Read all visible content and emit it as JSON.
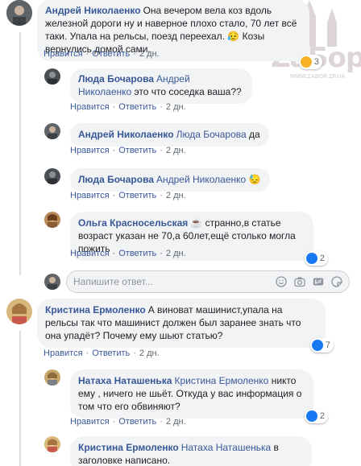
{
  "actions": {
    "like": "Нравится",
    "reply": "Ответить",
    "sep": "·"
  },
  "comments": [
    {
      "author": "Андрей Николаенко",
      "text": "Она вечером вела коз вдоль железной дороги ну и наверное плохо стало, 70 лет всё таки. Упала на рельсы, поезд переехал. 😥 Козы вернулись домой сами.",
      "time": "2 дн.",
      "reaction": {
        "icon": "sad-reaction-icon",
        "count": "3"
      }
    },
    {
      "author": "Люда Бочарова",
      "mention": "Андрей Николаенко",
      "text": "это что соседка ваша??",
      "time": "2 дн."
    },
    {
      "author": "Андрей Николаенко",
      "mention": "Люда Бочарова",
      "text": "да",
      "time": "2 дн."
    },
    {
      "author": "Люда Бочарова",
      "mention": "Андрей Николаенко",
      "text": "😓",
      "time": "2 дн."
    },
    {
      "author": "Ольга Красносельская",
      "text": "☕ странно,в статье возраст указан не 70,а 60лет,ещё столько могла пожить",
      "time": "2 дн.",
      "reaction": {
        "icon": "like-reaction-icon",
        "count": "2"
      }
    },
    {
      "author": "Кристина Ермоленко",
      "text": "А виноват машинист,упала на рельсы так что машинист должен был заранее знать что она упадёт? Почему ему шьют статью?",
      "time": "2 дн.",
      "reaction": {
        "icon": "like-reaction-icon",
        "count": "7"
      }
    },
    {
      "author": "Натаха Наташенька",
      "mention": "Кристина Ермоленко",
      "text": "никто ему , ничего не шьёт. Откуда у вас информация о том что его обвиняют?",
      "time": "2 дн.",
      "reaction": {
        "icon": "like-reaction-icon",
        "count": "2"
      }
    },
    {
      "author": "Кристина Ермоленко",
      "mention": "Натаха Наташенька",
      "text": "в заголовке написано."
    }
  ],
  "composer": {
    "placeholder": "Напишите ответ..."
  },
  "watermark": {
    "text": "ZaБор",
    "url": "WWW.ZABOR.ZP.UA"
  },
  "colors": {
    "link": "#385898",
    "bubble": "#f2f3f5",
    "like_blue": "#1877f2"
  }
}
